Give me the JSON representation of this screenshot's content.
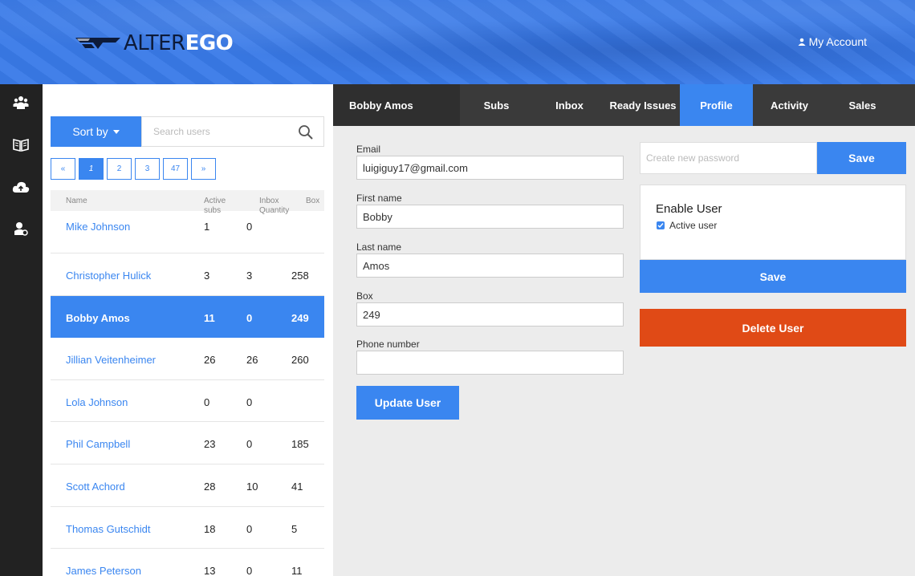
{
  "header": {
    "logo_part1": "ALTER",
    "logo_part2": "EGO",
    "account_label": "My Account"
  },
  "rail": {
    "icons": [
      "users-icon",
      "book-icon",
      "cloud-upload-icon",
      "user-settings-icon"
    ]
  },
  "users": {
    "sort_label": "Sort by",
    "search_placeholder": "Search users",
    "pagination": [
      "«",
      "1",
      "2",
      "3",
      "47",
      "»"
    ],
    "active_page": "1",
    "columns": {
      "name": "Name",
      "active_subs_1": "Active",
      "active_subs_2": "subs",
      "inbox_qty_1": "Inbox",
      "inbox_qty_2": "Quantity",
      "box": "Box"
    },
    "rows": [
      {
        "name": "Mike Johnson",
        "active_subs": "1",
        "inbox_qty": "0",
        "box": ""
      },
      {
        "name": "Christopher Hulick",
        "active_subs": "3",
        "inbox_qty": "3",
        "box": "258"
      },
      {
        "name": "Bobby Amos",
        "active_subs": "11",
        "inbox_qty": "0",
        "box": "249"
      },
      {
        "name": "Jillian Veitenheimer",
        "active_subs": "26",
        "inbox_qty": "26",
        "box": "260"
      },
      {
        "name": "Lola Johnson",
        "active_subs": "0",
        "inbox_qty": "0",
        "box": ""
      },
      {
        "name": "Phil Campbell",
        "active_subs": "23",
        "inbox_qty": "0",
        "box": "185"
      },
      {
        "name": "Scott Achord",
        "active_subs": "28",
        "inbox_qty": "10",
        "box": "41"
      },
      {
        "name": "Thomas Gutschidt",
        "active_subs": "18",
        "inbox_qty": "0",
        "box": "5"
      },
      {
        "name": "James Peterson",
        "active_subs": "13",
        "inbox_qty": "0",
        "box": "11"
      }
    ],
    "selected_row": 2
  },
  "tabs": {
    "user_name": "Bobby Amos",
    "items": [
      "Subs",
      "Inbox",
      "Ready Issues",
      "Profile",
      "Activity",
      "Sales"
    ],
    "active": "Profile"
  },
  "profile": {
    "email_label": "Email",
    "email_value": "luigiguy17@gmail.com",
    "first_name_label": "First name",
    "first_name_value": "Bobby",
    "last_name_label": "Last name",
    "last_name_value": "Amos",
    "box_label": "Box",
    "box_value": "249",
    "phone_label": "Phone number",
    "phone_value": "",
    "update_label": "Update User"
  },
  "account_actions": {
    "password_placeholder": "Create new password",
    "password_save_label": "Save",
    "enable_title": "Enable User",
    "active_checkbox_label": "Active user",
    "active_checked": true,
    "enable_save_label": "Save",
    "delete_label": "Delete User"
  },
  "colors": {
    "accent": "#3a86f0",
    "header_bg": "#3a7be8",
    "danger": "#e04a16",
    "rail_bg": "#222222",
    "tabs_bg": "#3a3a3a"
  }
}
